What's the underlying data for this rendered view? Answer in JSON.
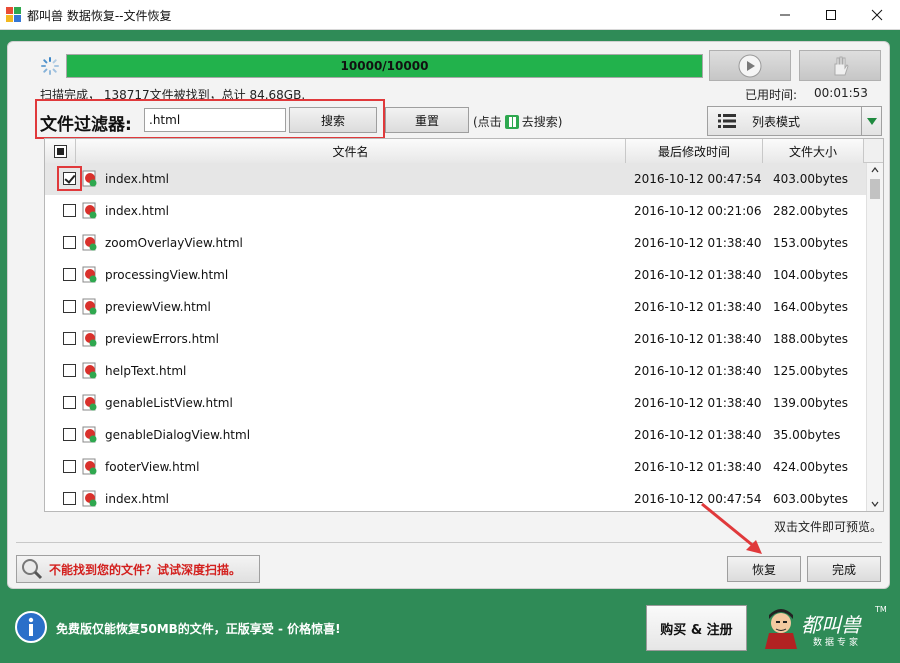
{
  "window": {
    "title": "都叫兽 数据恢复--文件恢复"
  },
  "scan": {
    "progress_text": "10000/10000",
    "progress_fraction": 1.0,
    "status": "扫描完成，  138717文件被找到，总计 84.68GB.",
    "elapsed_label": "已用时间:",
    "elapsed_value": "00:01:53"
  },
  "filter": {
    "label": "文件过滤器:",
    "value": ".html",
    "search_label": "搜索",
    "reset_label": "重置",
    "hint_prefix": "(点击",
    "hint_suffix": "去搜索)"
  },
  "view_mode": {
    "label": "列表模式"
  },
  "table": {
    "columns": [
      "文件名",
      "最后修改时间",
      "文件大小"
    ],
    "rows": [
      {
        "name": "index.html",
        "date": "2016-10-12 00:47:54",
        "size": "403.00bytes",
        "checked": true
      },
      {
        "name": "index.html",
        "date": "2016-10-12 00:21:06",
        "size": "282.00bytes",
        "checked": false
      },
      {
        "name": "zoomOverlayView.html",
        "date": "2016-10-12 01:38:40",
        "size": "153.00bytes",
        "checked": false
      },
      {
        "name": "processingView.html",
        "date": "2016-10-12 01:38:40",
        "size": "104.00bytes",
        "checked": false
      },
      {
        "name": "previewView.html",
        "date": "2016-10-12 01:38:40",
        "size": "164.00bytes",
        "checked": false
      },
      {
        "name": "previewErrors.html",
        "date": "2016-10-12 01:38:40",
        "size": "188.00bytes",
        "checked": false
      },
      {
        "name": "helpText.html",
        "date": "2016-10-12 01:38:40",
        "size": "125.00bytes",
        "checked": false
      },
      {
        "name": "genableListView.html",
        "date": "2016-10-12 01:38:40",
        "size": "139.00bytes",
        "checked": false
      },
      {
        "name": "genableDialogView.html",
        "date": "2016-10-12 01:38:40",
        "size": "35.00bytes",
        "checked": false
      },
      {
        "name": "footerView.html",
        "date": "2016-10-12 01:38:40",
        "size": "424.00bytes",
        "checked": false
      },
      {
        "name": "index.html",
        "date": "2016-10-12 00:47:54",
        "size": "603.00bytes",
        "checked": false
      }
    ]
  },
  "footer": {
    "preview_hint": "双击文件即可预览。",
    "deep_scan_label": "不能找到您的文件？试试深度扫描。",
    "restore_label": "恢复",
    "done_label": "完成"
  },
  "promo_bar": {
    "message": "免费版仅能恢复50MB的文件，正版享受 - 价格惊喜!",
    "buy_label": "购买 & 注册",
    "brand_name": "都叫兽",
    "brand_sub": "数据专家",
    "brand_tm": "TM"
  },
  "colors": {
    "accent_green": "#2f8b57",
    "progress_green": "#22b24c",
    "highlight_red": "#e0393b",
    "warning_red": "#d3201e"
  }
}
